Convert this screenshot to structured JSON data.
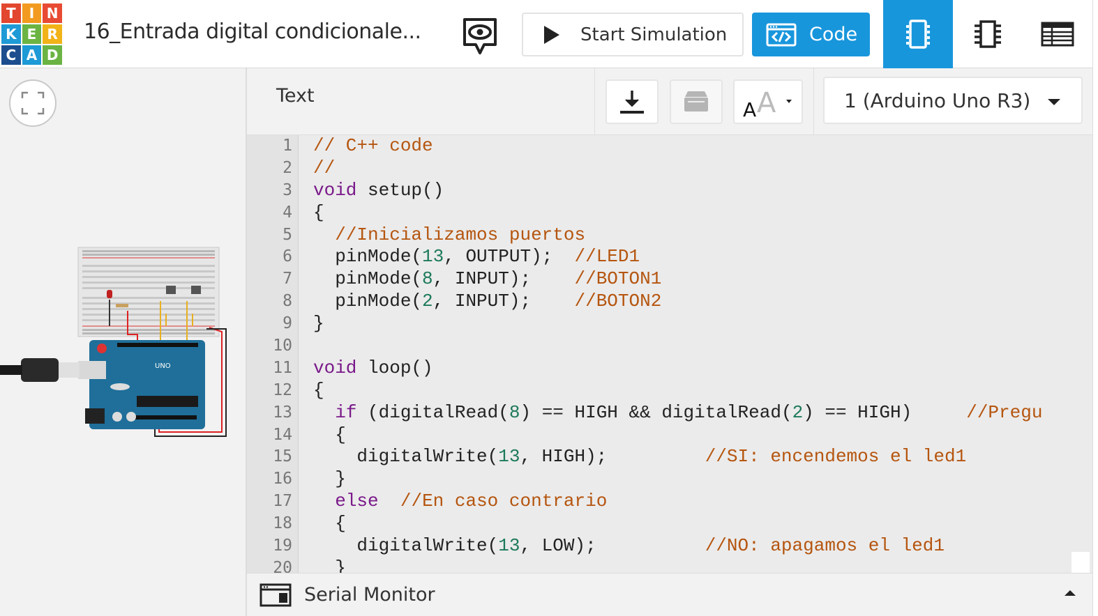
{
  "app": {
    "logo_letters": [
      "T",
      "I",
      "N",
      "K",
      "E",
      "R",
      "C",
      "A",
      "D"
    ],
    "project_title": "16_Entrada digital condicionale..."
  },
  "toolbar": {
    "start_simulation_label": "Start Simulation",
    "code_label": "Code",
    "icons": [
      "eye-chat-icon",
      "play-icon",
      "code-window-icon",
      "component-view-icon",
      "schematic-view-icon",
      "list-view-icon"
    ]
  },
  "code_panel": {
    "mode_label": "Text",
    "board_select": "1 (Arduino Uno R3)",
    "tool_icons": [
      "download-icon",
      "library-icon",
      "font-size-icon"
    ]
  },
  "editor": {
    "line_numbers": [
      "1",
      "2",
      "3",
      "4",
      "5",
      "6",
      "7",
      "8",
      "9",
      "10",
      "11",
      "12",
      "13",
      "14",
      "15",
      "16",
      "17",
      "18",
      "19",
      "20"
    ],
    "lines": [
      [
        {
          "t": "// C++ code",
          "c": "com"
        }
      ],
      [
        {
          "t": "//",
          "c": "com"
        }
      ],
      [
        {
          "t": "void",
          "c": "kw"
        },
        {
          "t": " setup()",
          "c": ""
        }
      ],
      [
        {
          "t": "{",
          "c": ""
        }
      ],
      [
        {
          "t": "  ",
          "c": ""
        },
        {
          "t": "//Inicializamos puertos",
          "c": "com"
        }
      ],
      [
        {
          "t": "  pinMode(",
          "c": ""
        },
        {
          "t": "13",
          "c": "num"
        },
        {
          "t": ", OUTPUT);  ",
          "c": ""
        },
        {
          "t": "//LED1",
          "c": "com"
        }
      ],
      [
        {
          "t": "  pinMode(",
          "c": ""
        },
        {
          "t": "8",
          "c": "num"
        },
        {
          "t": ", INPUT);    ",
          "c": ""
        },
        {
          "t": "//BOTON1",
          "c": "com"
        }
      ],
      [
        {
          "t": "  pinMode(",
          "c": ""
        },
        {
          "t": "2",
          "c": "num"
        },
        {
          "t": ", INPUT);    ",
          "c": ""
        },
        {
          "t": "//BOTON2",
          "c": "com"
        }
      ],
      [
        {
          "t": "}",
          "c": ""
        }
      ],
      [
        {
          "t": "",
          "c": ""
        }
      ],
      [
        {
          "t": "void",
          "c": "kw"
        },
        {
          "t": " loop()",
          "c": ""
        }
      ],
      [
        {
          "t": "{",
          "c": ""
        }
      ],
      [
        {
          "t": "  ",
          "c": ""
        },
        {
          "t": "if",
          "c": "kw"
        },
        {
          "t": " (digitalRead(",
          "c": ""
        },
        {
          "t": "8",
          "c": "num"
        },
        {
          "t": ") == HIGH && digitalRead(",
          "c": ""
        },
        {
          "t": "2",
          "c": "num"
        },
        {
          "t": ") == HIGH)     ",
          "c": ""
        },
        {
          "t": "//Pregu",
          "c": "com"
        }
      ],
      [
        {
          "t": "  {",
          "c": ""
        }
      ],
      [
        {
          "t": "    digitalWrite(",
          "c": ""
        },
        {
          "t": "13",
          "c": "num"
        },
        {
          "t": ", HIGH);         ",
          "c": ""
        },
        {
          "t": "//SI: encendemos el led1",
          "c": "com"
        }
      ],
      [
        {
          "t": "  }",
          "c": ""
        }
      ],
      [
        {
          "t": "  ",
          "c": ""
        },
        {
          "t": "else",
          "c": "kw"
        },
        {
          "t": "  ",
          "c": ""
        },
        {
          "t": "//En caso contrario",
          "c": "com"
        }
      ],
      [
        {
          "t": "  {",
          "c": ""
        }
      ],
      [
        {
          "t": "    digitalWrite(",
          "c": ""
        },
        {
          "t": "13",
          "c": "num"
        },
        {
          "t": ", LOW);          ",
          "c": ""
        },
        {
          "t": "//NO: apagamos el led1",
          "c": "com"
        }
      ],
      [
        {
          "t": "  }",
          "c": ""
        }
      ]
    ]
  },
  "serial_monitor": {
    "label": "Serial Monitor"
  },
  "colors": {
    "accent": "#1896dc",
    "comment": "#b5550f",
    "keyword": "#7a1a8a",
    "number": "#1d7a5a"
  }
}
